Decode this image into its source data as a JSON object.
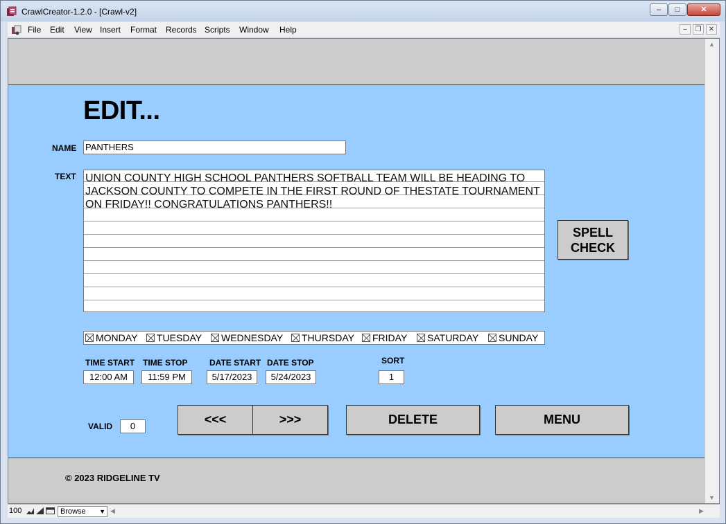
{
  "window": {
    "title": "CrawlCreator-1.2.0 - [Crawl-v2]",
    "controls": {
      "minimize": "–",
      "maximize": "□",
      "close": "✕"
    }
  },
  "menubar": {
    "items": [
      "File",
      "Edit",
      "View",
      "Insert",
      "Format",
      "Records",
      "Scripts",
      "Window",
      "Help"
    ],
    "mdi_controls": {
      "minimize": "–",
      "restore": "❐",
      "close": "✕"
    }
  },
  "form": {
    "title": "EDIT...",
    "name_label": "NAME",
    "name_value": "PANTHERS",
    "text_label": "TEXT",
    "text_value": "UNION COUNTY HIGH SCHOOL PANTHERS SOFTBALL TEAM WILL BE HEADING TO JACKSON COUNTY TO COMPETE IN THE FIRST ROUND OF THESTATE TOURNAMENT ON FRIDAY!! CONGRATULATIONS PANTHERS!!",
    "spell_check_line1": "SPELL",
    "spell_check_line2": "CHECK",
    "days": [
      {
        "label": "MONDAY",
        "checked": true
      },
      {
        "label": "TUESDAY",
        "checked": true
      },
      {
        "label": "WEDNESDAY",
        "checked": true
      },
      {
        "label": "THURSDAY",
        "checked": true
      },
      {
        "label": "FRIDAY",
        "checked": true
      },
      {
        "label": "SATURDAY",
        "checked": true
      },
      {
        "label": "SUNDAY",
        "checked": true
      }
    ],
    "time_start_label": "TIME START",
    "time_start_value": "12:00 AM",
    "time_stop_label": "TIME STOP",
    "time_stop_value": "11:59 PM",
    "date_start_label": "DATE START",
    "date_start_value": "5/17/2023",
    "date_stop_label": "DATE STOP",
    "date_stop_value": "5/24/2023",
    "sort_label": "SORT",
    "sort_value": "1",
    "valid_label": "VALID",
    "valid_value": "0",
    "prev_button": "<<<",
    "next_button": ">>>",
    "delete_button": "DELETE",
    "menu_button": "MENU",
    "copyright": "©  2023 RIDGELINE TV"
  },
  "statusbar": {
    "zoom": "100",
    "mode": "Browse"
  },
  "colors": {
    "body_band": "#99ccff",
    "header_footer_band": "#cccccc",
    "button": "#cccccc"
  }
}
